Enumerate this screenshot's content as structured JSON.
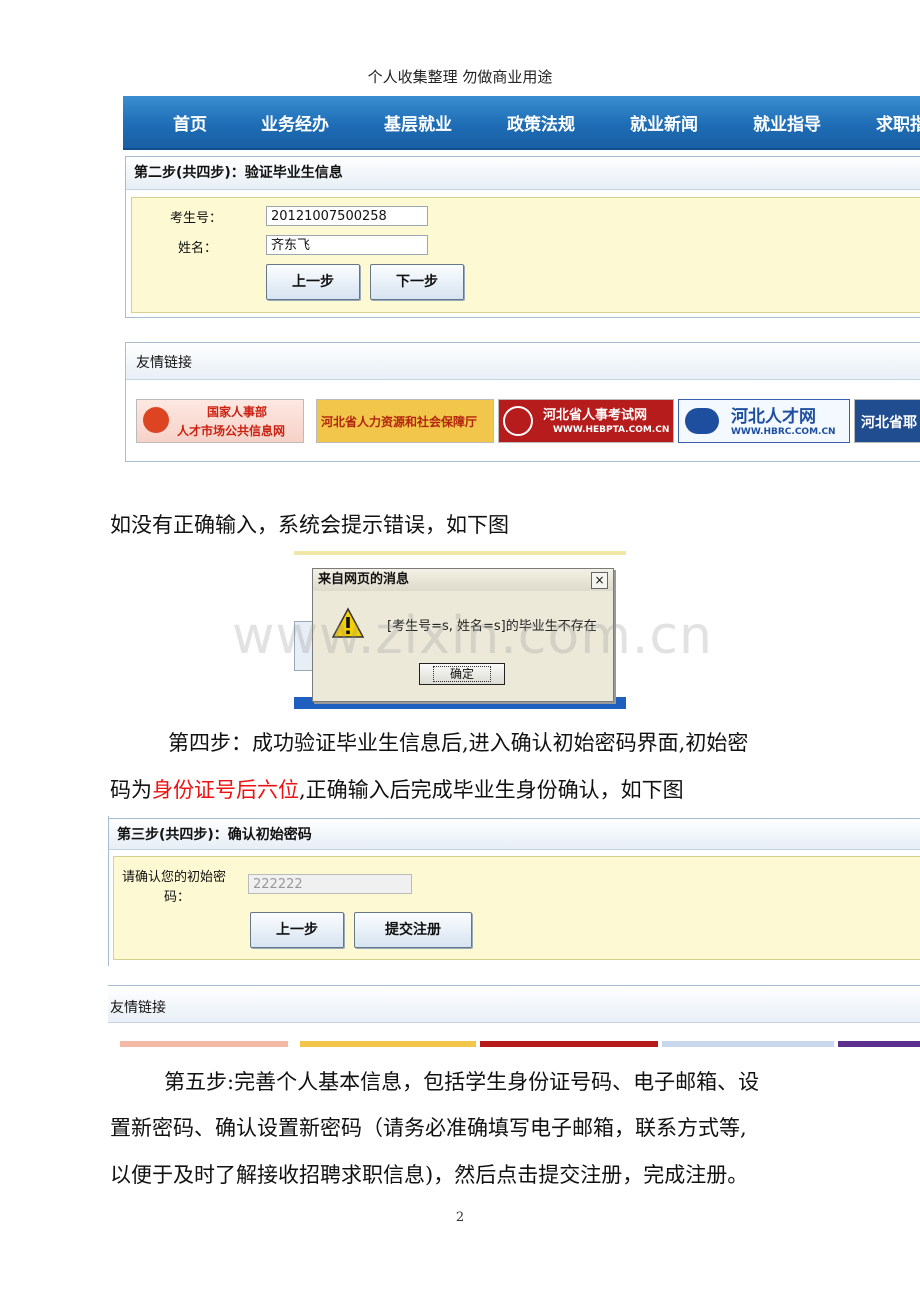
{
  "header_note": "个人收集整理 勿做商业用途",
  "screenshot1": {
    "nav": [
      "首页",
      "业务经办",
      "基层就业",
      "政策法规",
      "就业新闻",
      "就业指导",
      "求职指"
    ],
    "step_title": "第二步(共四步)：验证毕业生信息",
    "exam_label": "考生号：",
    "exam_value": "20121007500258",
    "name_label": "姓名：",
    "name_value": "齐东飞",
    "prev_btn": "上一步",
    "next_btn": "下一步",
    "friends_title": "友情链接",
    "logos": [
      {
        "line1": "国家人事部",
        "line2": "人才市场公共信息网"
      },
      {
        "text": "河北省人力资源和社会保障厅"
      },
      {
        "text": "河北省人事考试网",
        "sub": "WWW.HEBPTA.COM.CN"
      },
      {
        "text": "河北人才网",
        "sub": "WWW.HBRC.COM.CN"
      },
      {
        "text": "河北省耶"
      }
    ]
  },
  "para1": "如没有正确输入，系统会提示错误，如下图",
  "dialog": {
    "title": "来自网页的消息",
    "close": "×",
    "message": "[考生号=s, 姓名=s]的毕业生不存在",
    "ok": "确定"
  },
  "watermark": "www.zixin.com.cn",
  "para2": {
    "line1": "第四步：成功验证毕业生信息后,进入确认初始密码界面,初始密",
    "line2_a": "码为",
    "line2_red": "身份证号后六位",
    "line2_b": ",正确输入后完成毕业生身份确认，如下图"
  },
  "screenshot3": {
    "step_title": "第三步(共四步)：确认初始密码",
    "pw_label_1": "请确认您的初始密",
    "pw_label_2": "码：",
    "pw_value": "222222",
    "prev_btn": "上一步",
    "submit_btn": "提交注册",
    "friends_title": "友情链接"
  },
  "para3": {
    "line1": "第五步:完善个人基本信息，包括学生身份证号码、电子邮箱、设",
    "line2": "置新密码、确认设置新密码（请务必准确填写电子邮箱，联系方式等,",
    "line3": "以便于及时了解接收招聘求职信息)，然后点击提交注册，完成注册。"
  },
  "page_number": "2"
}
